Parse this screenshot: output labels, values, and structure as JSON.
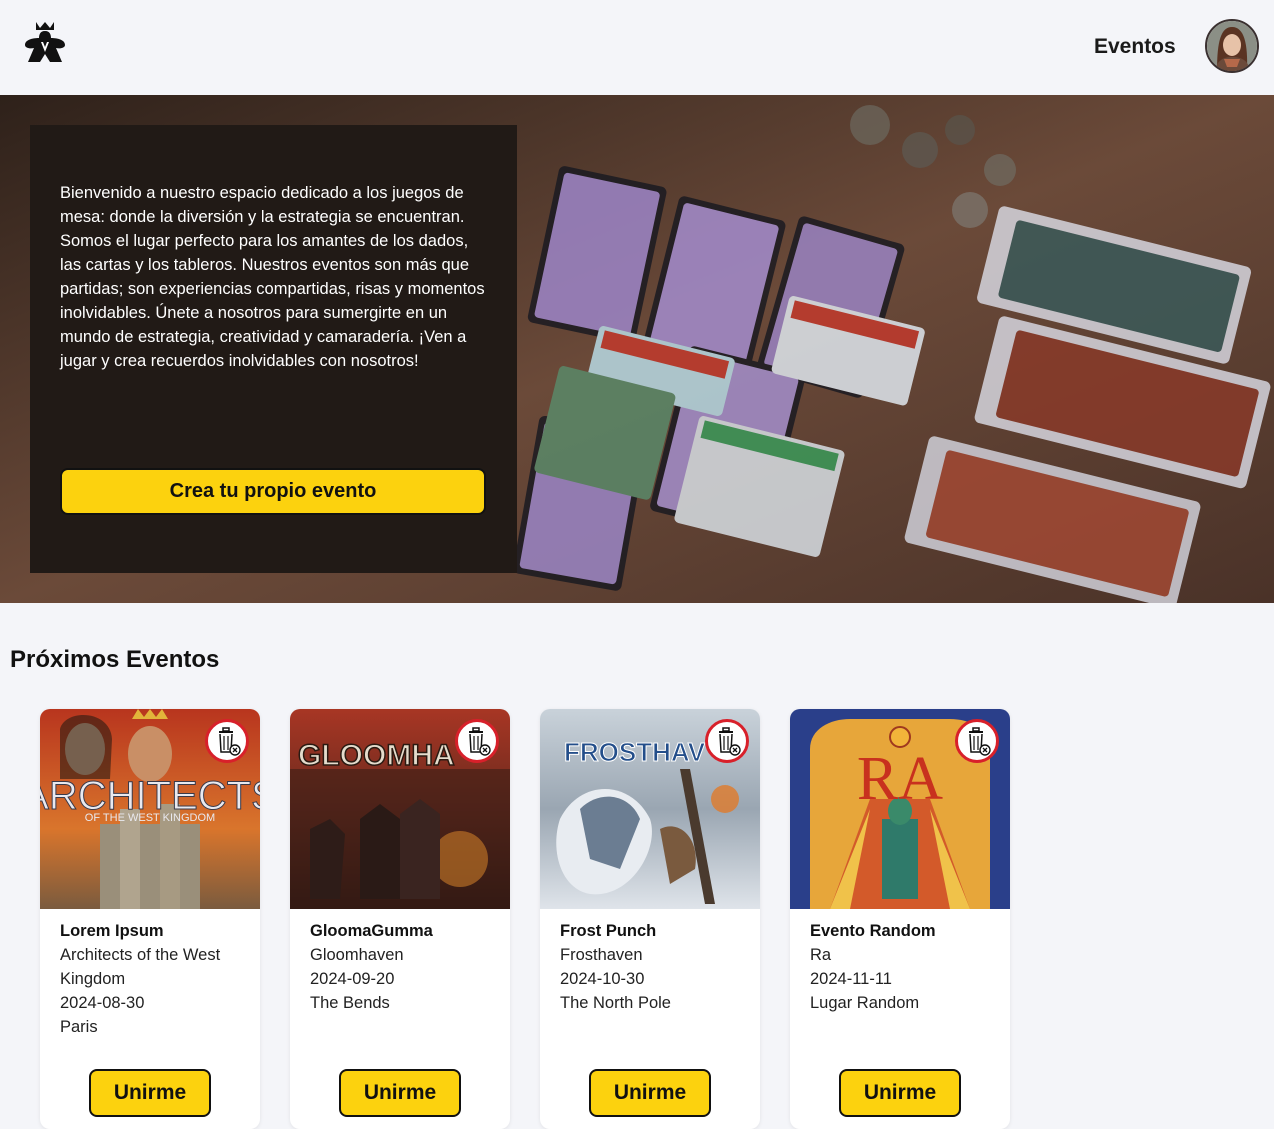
{
  "header": {
    "nav_events": "Eventos",
    "logo_icon": "meeple-crown-icon",
    "avatar_icon": "user-avatar"
  },
  "hero": {
    "text": "Bienvenido a nuestro espacio dedicado a los juegos de mesa: donde la diversión y la estrategia se encuentran. Somos el lugar perfecto para los amantes de los dados, las cartas y los tableros. Nuestros eventos son más que partidas; son experiencias compartidas, risas y momentos inolvidables. Únete a nosotros para sumergirte en un mundo de estrategia, creatividad y camaradería. ¡Ven a jugar y crea recuerdos inolvidables con nosotros!",
    "cta": "Crea tu propio evento"
  },
  "events": {
    "title": "Próximos Eventos",
    "items": [
      {
        "name": "Lorem Ipsum",
        "game": "Architects of the West Kingdom",
        "date": "2024-08-30",
        "place": "Paris",
        "join": "Unirme",
        "cover_title": "ARCHITECTS",
        "cover_sub": "OF THE WEST KINGDOM"
      },
      {
        "name": "GloomaGumma",
        "game": "Gloomhaven",
        "date": "2024-09-20",
        "place": "The Bends",
        "join": "Unirme",
        "cover_title": "GLOOMHA",
        "cover_sub": ""
      },
      {
        "name": "Frost Punch",
        "game": "Frosthaven",
        "date": "2024-10-30",
        "place": "The North Pole",
        "join": "Unirme",
        "cover_title": "FROSTHAV",
        "cover_sub": ""
      },
      {
        "name": "Evento Random",
        "game": "Ra",
        "date": "2024-11-11",
        "place": "Lugar Random",
        "join": "Unirme",
        "cover_title": "RA",
        "cover_sub": ""
      }
    ]
  },
  "colors": {
    "accent_yellow": "#fcd20e",
    "panel_dark": "#211a16",
    "delete_red": "#d8202a"
  }
}
